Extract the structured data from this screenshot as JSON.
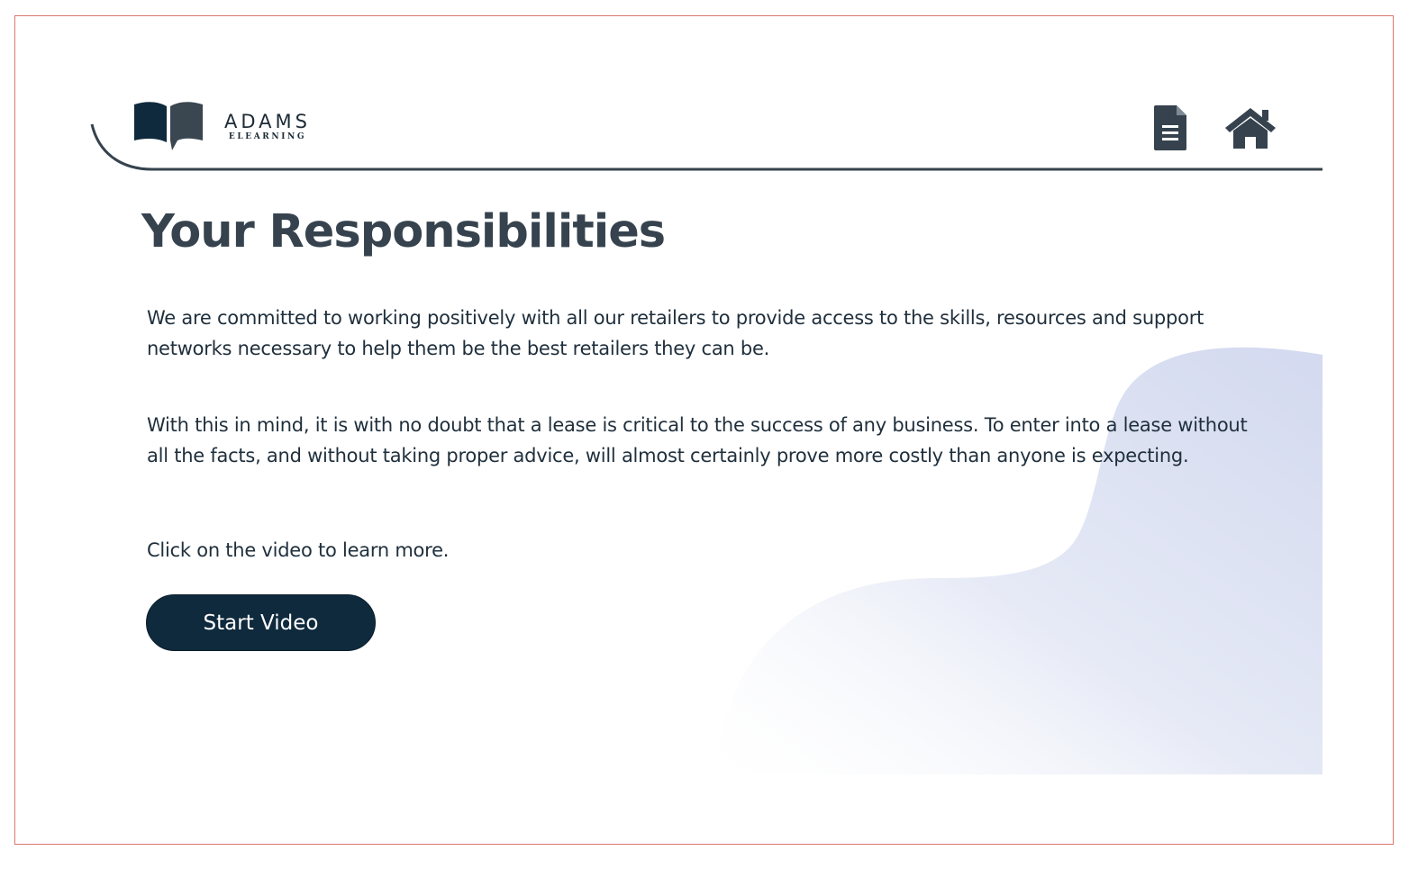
{
  "logo": {
    "name": "ADAMS",
    "sub": "ELEARNING"
  },
  "nav": {
    "icons": [
      "document-icon",
      "home-icon"
    ]
  },
  "content": {
    "title": "Your Responsibilities",
    "paragraph_1": "We are committed to working positively with all our retailers to provide access to the skills, resources and support networks necessary to help them be the best retailers they can be.",
    "paragraph_2": "With this in mind, it is with no doubt that a lease is critical to the success of any business. To enter into a lease without all the facts, and without taking proper advice, will almost certainly prove more costly than anyone is expecting.",
    "instruction": "Click on the video to learn more.",
    "button_label": "Start Video"
  },
  "colors": {
    "primary_dark": "#0f2a3d",
    "text": "#1f2f3c",
    "title": "#36434e",
    "frame_border": "#d9786d",
    "blob": "#d5dbf0"
  }
}
